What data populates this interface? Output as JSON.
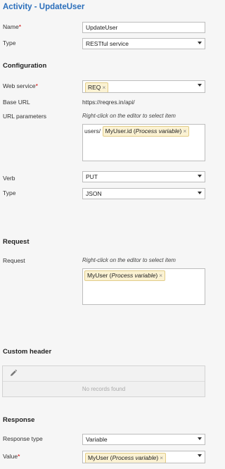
{
  "title": "Activity  - UpdateUser",
  "fields": {
    "name": {
      "label": "Name",
      "required_mark": "*",
      "value": "UpdateUser"
    },
    "type": {
      "label": "Type",
      "value": "RESTful service"
    }
  },
  "configuration": {
    "heading": "Configuration",
    "web_service": {
      "label": "Web service",
      "required_mark": "*",
      "token": "REQ",
      "remove": "×"
    },
    "base_url": {
      "label": "Base URL",
      "value": "https://reqres.in/api/"
    },
    "url_parameters": {
      "label": "URL parameters",
      "hint": "Right-click on the editor to select item",
      "prefix_text": "users/",
      "token_name": "MyUser.id",
      "token_type": "Process variable",
      "remove": "×"
    },
    "verb": {
      "label": "Verb",
      "value": "PUT"
    },
    "type": {
      "label": "Type",
      "value": "JSON"
    }
  },
  "request": {
    "heading": "Request",
    "label": "Request",
    "hint": "Right-click on the editor to select item",
    "token_name": "MyUser",
    "token_type": "Process variable",
    "remove": "×"
  },
  "custom_header": {
    "heading": "Custom header",
    "toolbar_icon": "pencil-icon",
    "empty_text": "No records found"
  },
  "response": {
    "heading": "Response",
    "response_type": {
      "label": "Response type",
      "value": "Variable"
    },
    "value": {
      "label": "Value",
      "required_mark": "*",
      "token_name": "MyUser",
      "token_type": "Process variable",
      "remove": "×"
    }
  },
  "colors": {
    "title": "#2a6ebb",
    "required": "#cc0000",
    "token_bg": "#fbf2d3",
    "token_border": "#e2cc88"
  }
}
